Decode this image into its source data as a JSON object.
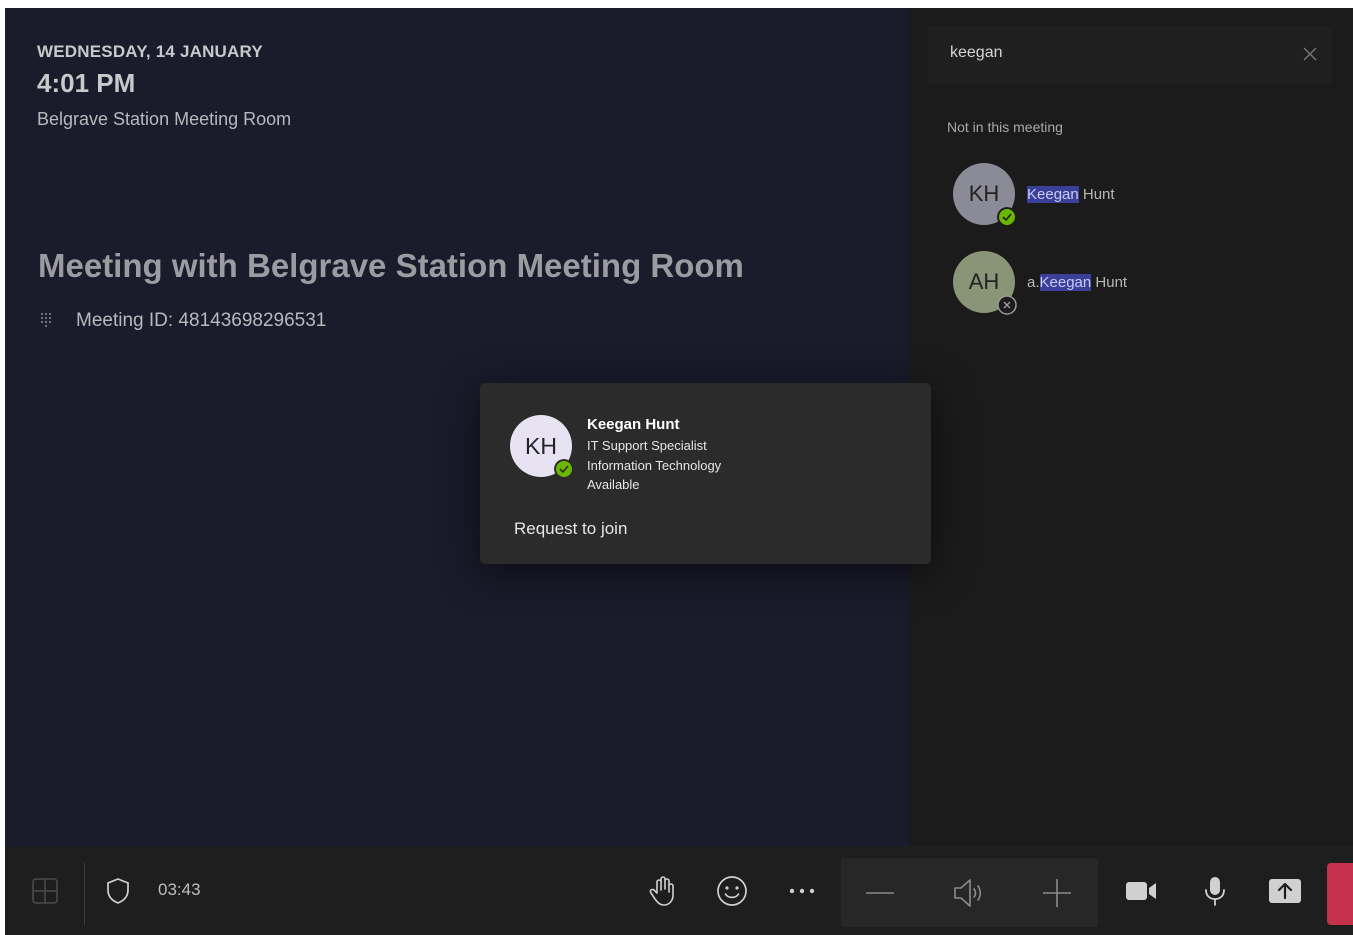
{
  "meeting": {
    "date": "WEDNESDAY, 14 JANUARY",
    "time": "4:01 PM",
    "room": "Belgrave Station Meeting Room",
    "title": "Meeting with Belgrave Station Meeting Room",
    "id_label": "Meeting ID: 48143698296531"
  },
  "search": {
    "value": "keegan"
  },
  "results": {
    "section_label": "Not in this meeting",
    "people": [
      {
        "initials": "KH",
        "prefix": "",
        "highlight": "Keegan",
        "rest": " Hunt",
        "status": "available",
        "avatar_color": "#8b8b97"
      },
      {
        "initials": "AH",
        "prefix": "a.",
        "highlight": "Keegan",
        "rest": " Hunt",
        "status": "offline",
        "avatar_color": "#8a9477"
      }
    ]
  },
  "card": {
    "initials": "KH",
    "name": "Keegan Hunt",
    "role": "IT Support Specialist",
    "department": "Information Technology",
    "status": "Available",
    "action": "Request to join"
  },
  "toolbar": {
    "timer": "03:43"
  },
  "colors": {
    "available": "#6bb700",
    "leave": "#c4314b"
  }
}
